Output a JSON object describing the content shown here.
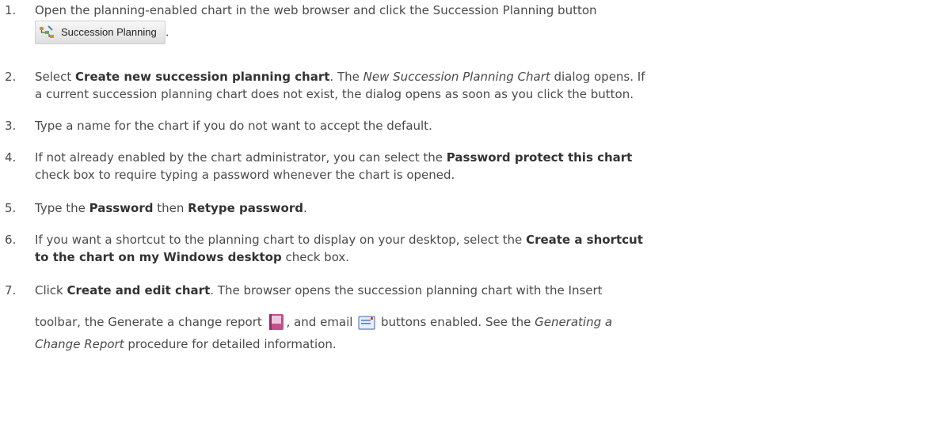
{
  "steps": [
    {
      "num": "1.",
      "t1": "Open the planning-enabled chart in the web browser and click the Succession Planning button",
      "button_label": "Succession Planning",
      "t2": "."
    },
    {
      "num": "2.",
      "t1": "Select ",
      "b1": "Create new succession planning chart",
      "t2": ". The ",
      "i1": "New Succession Planning Chart",
      "t3": " dialog opens. If",
      "line2": "a current succession planning chart does not exist, the dialog opens as soon as you click the button."
    },
    {
      "num": "3.",
      "t1": "Type a name for the chart if you do not want to accept the default."
    },
    {
      "num": "4.",
      "t1": "If not already enabled by the chart administrator, you can select the ",
      "b1": "Password protect this chart",
      "line2": "check box to require typing a password whenever the chart is opened."
    },
    {
      "num": "5.",
      "t1": "Type the ",
      "b1": "Password",
      "t2": " then ",
      "b2": "Retype password",
      "t3": "."
    },
    {
      "num": "6.",
      "t1": "If you want a shortcut to the planning chart to display on your desktop, select the ",
      "b1": "Create a shortcut",
      "b2": "to the chart on my Windows desktop",
      "t2": " check box."
    },
    {
      "num": "7.",
      "t1": "Click ",
      "b1": "Create and edit chart",
      "t2": ". The browser opens the succession planning chart with the Insert",
      "t3": "toolbar, the Generate a change report ",
      "t4": ", and email ",
      "t5": " buttons enabled. See the ",
      "i1": "Generating a",
      "i2": "Change Report",
      "t6": " procedure for detailed information."
    }
  ]
}
